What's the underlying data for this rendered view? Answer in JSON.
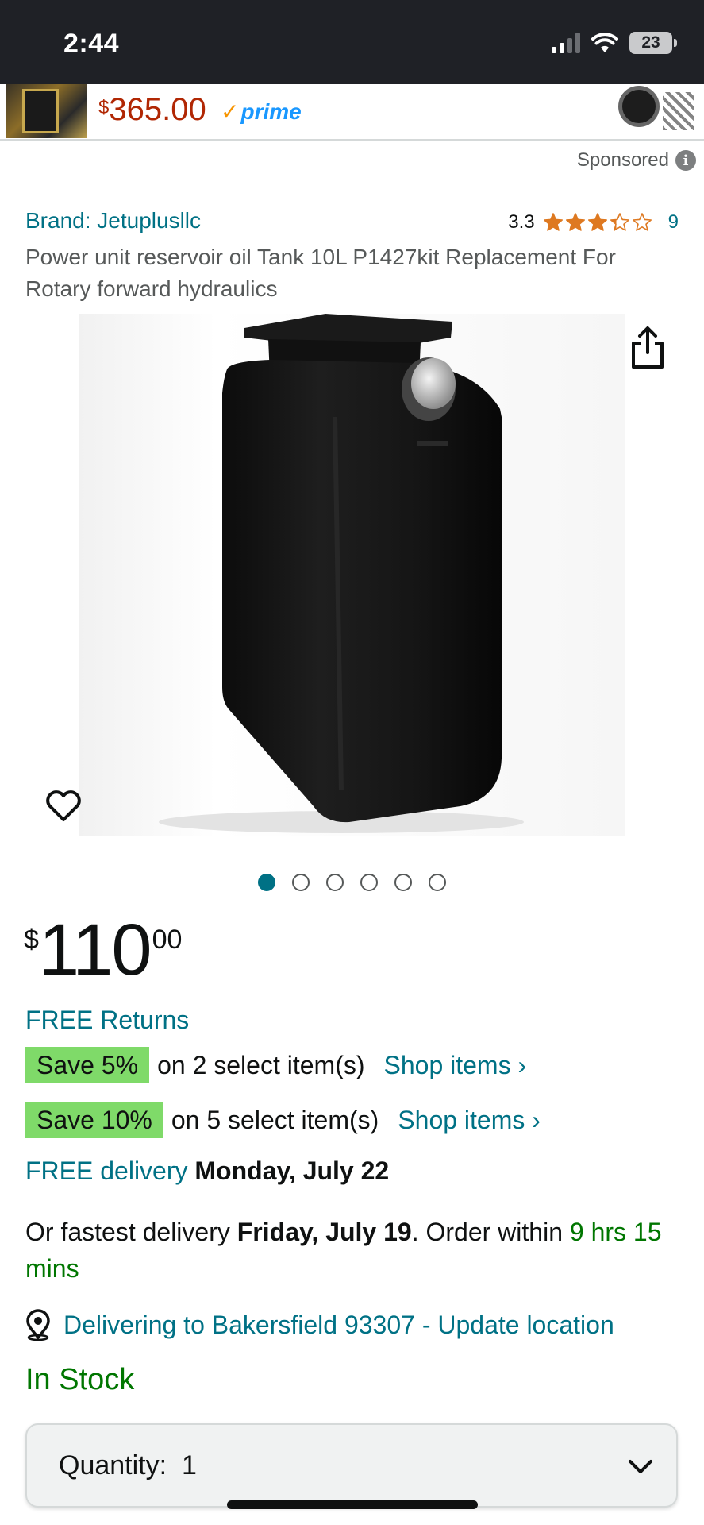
{
  "status_bar": {
    "time": "2:44",
    "battery": "23"
  },
  "ad": {
    "price_symbol": "$",
    "price": "365.00",
    "prime_label": "prime"
  },
  "sponsored_label": "Sponsored",
  "product": {
    "brand": "Brand: Jetuplusllc",
    "rating": "3.3",
    "rating_value": 3.3,
    "rating_count": "9",
    "title": "Power unit reservoir oil Tank 10L P1427kit Replacement For Rotary forward hydraulics",
    "image_count": 6,
    "active_image": 0,
    "price": {
      "symbol": "$",
      "whole": "110",
      "fraction": "00"
    }
  },
  "free_returns": "FREE Returns",
  "promos": [
    {
      "badge": "Save 5%",
      "text": "on 2 select item(s)",
      "link": "Shop items ›"
    },
    {
      "badge": "Save 10%",
      "text": "on 5 select item(s)",
      "link": "Shop items ›"
    }
  ],
  "delivery": {
    "free_label": "FREE delivery",
    "free_date": "Monday, July 22",
    "fastest_prefix": "Or fastest delivery",
    "fastest_date": "Friday, July 19",
    "order_within": ". Order within",
    "countdown": "9 hrs 15 mins"
  },
  "location": "Delivering to Bakersfield 93307 - Update location",
  "stock": "In Stock",
  "quantity": {
    "label": "Quantity:",
    "value": "1"
  },
  "colors": {
    "link": "#007185",
    "price_red": "#b12704",
    "green": "#007600",
    "save_badge": "#7fda69",
    "star": "#de7921"
  }
}
